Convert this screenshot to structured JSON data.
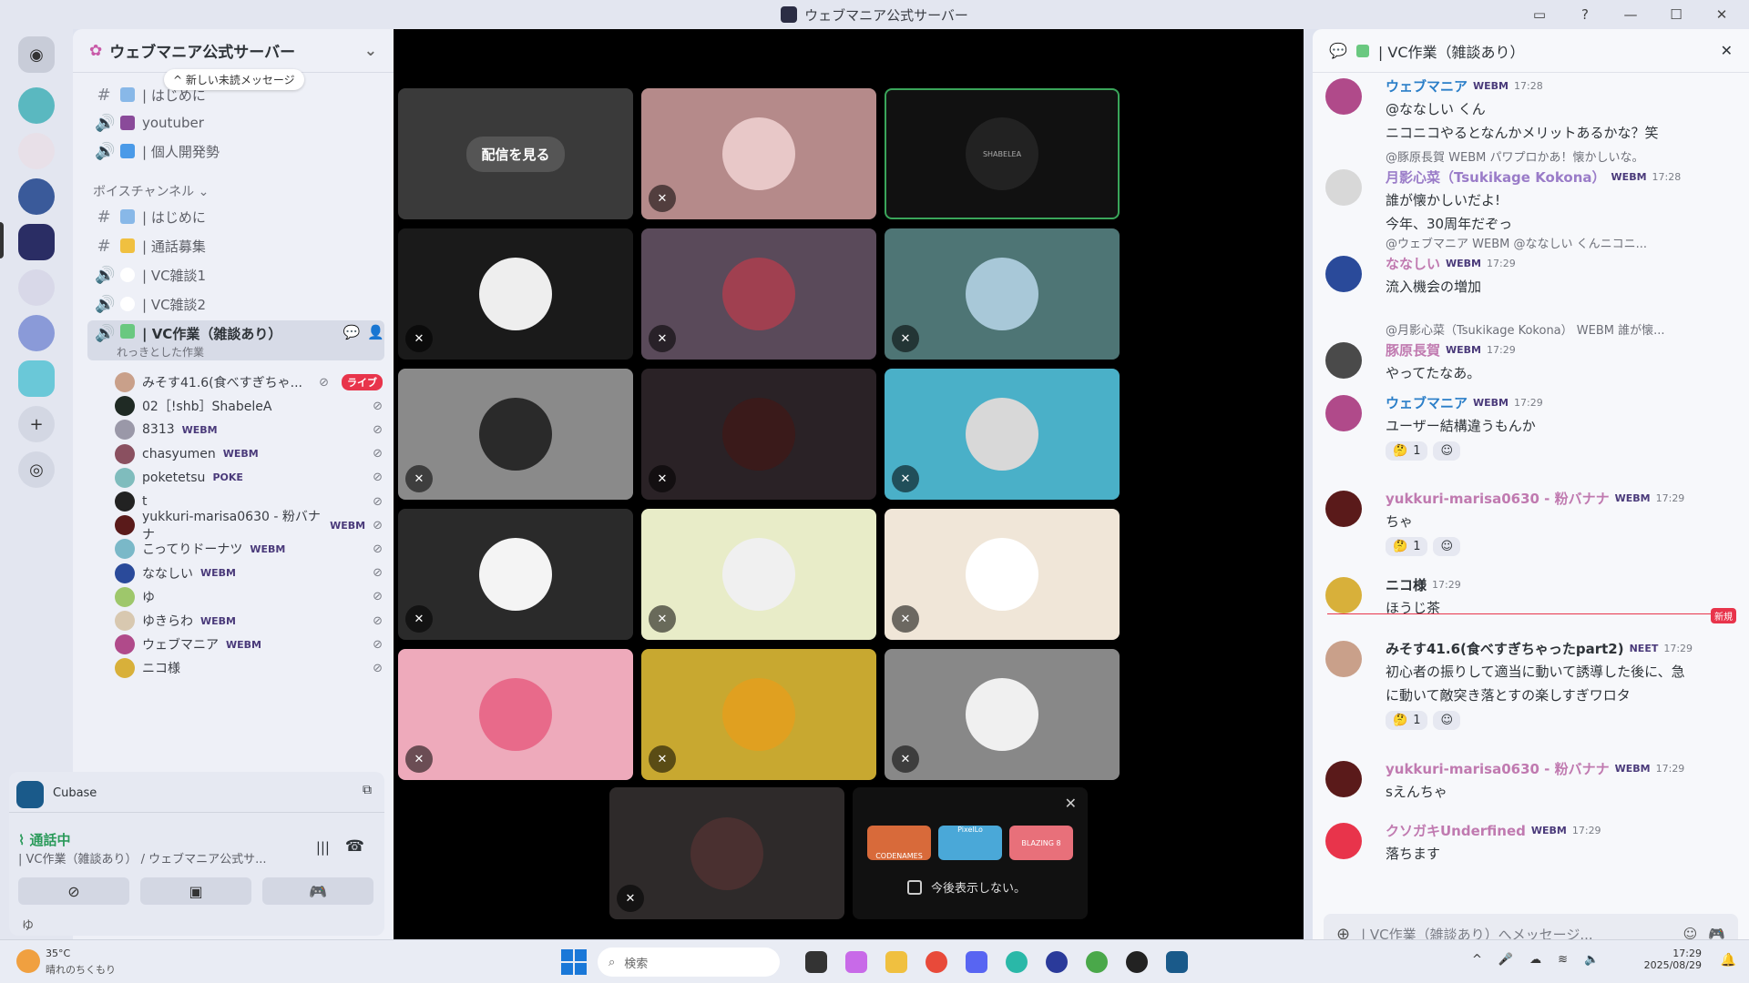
{
  "window": {
    "title": "ウェブマニア公式サーバー"
  },
  "server": {
    "name": "ウェブマニア公式サーバー",
    "new_messages": "新しい未読メッセージ",
    "channels": [
      {
        "label": "| はじめに",
        "type": "text"
      },
      {
        "label": "youtuber",
        "type": "voice"
      },
      {
        "label": "| 個人開発勢",
        "type": "voice"
      }
    ],
    "voice_category": "ボイスチャンネル",
    "voice_channels": [
      {
        "label": "| はじめに",
        "type": "text"
      },
      {
        "label": "| 通話募集",
        "type": "text"
      },
      {
        "label": "| VC雑談1",
        "type": "voice"
      },
      {
        "label": "| VC雑談2",
        "type": "voice"
      },
      {
        "label": "| VC作業（雑談あり）",
        "type": "voice",
        "status": "れっきとした作業"
      }
    ],
    "voice_members": [
      {
        "name": "みそす41.6(食べすぎちゃ...",
        "tag": "",
        "live": "ライブ",
        "color": "#c9a08a"
      },
      {
        "name": "02［!shb］ShabeleA",
        "tag": "",
        "color": "#1f2a24"
      },
      {
        "name": "8313",
        "tag": "WEBM",
        "color": "#9a98a8"
      },
      {
        "name": "chasyumen",
        "tag": "WEBM",
        "color": "#8a5060"
      },
      {
        "name": "poketetsu",
        "tag": "POKE",
        "color": "#7fbcbd"
      },
      {
        "name": "t",
        "tag": "",
        "color": "#222"
      },
      {
        "name": "yukkuri-marisa0630 - 粉バナナ",
        "tag": "WEBM",
        "color": "#5a1a1a"
      },
      {
        "name": "こってりドーナツ",
        "tag": "WEBM",
        "color": "#7ab8c8"
      },
      {
        "name": "ななしい",
        "tag": "WEBM",
        "color": "#2a4a9a"
      },
      {
        "name": "ゆ",
        "tag": "",
        "color": "#9ec76b"
      },
      {
        "name": "ゆきらわ",
        "tag": "WEBM",
        "color": "#d8c8b0"
      },
      {
        "name": "ウェブマニア",
        "tag": "WEBM",
        "color": "#b04a8a"
      },
      {
        "name": "ニコ様",
        "tag": "",
        "color": "#d8b03a"
      }
    ]
  },
  "user_panel": {
    "activity": "Cubase",
    "status": "通話中",
    "channel": "| VC作業（雑談あり） / ウェブマニア公式サ...",
    "user": "ゆ"
  },
  "stage": {
    "watch_label": "配信を見る",
    "shabelea_label": "SHABELEA",
    "tiles": [
      {
        "bg": "#3a3a3a",
        "avatar": "",
        "muted": false,
        "stream": true
      },
      {
        "bg": "#b58a8a",
        "avatar": "#e8c8c8",
        "muted": true
      },
      {
        "bg": "#111111",
        "avatar": "#222222",
        "muted": false,
        "speaking": true
      },
      {
        "bg": "#1a1a1a",
        "avatar": "#eeeeee",
        "muted": true
      },
      {
        "bg": "#5a4a5a",
        "avatar": "#a04050",
        "muted": true
      },
      {
        "bg": "#4e7575",
        "avatar": "#a8c8d8",
        "muted": true
      },
      {
        "bg": "#8a8a8a",
        "avatar": "#2a2a2a",
        "muted": true
      },
      {
        "bg": "#2a2226",
        "avatar": "#3a1a1a",
        "muted": true
      },
      {
        "bg": "#4ab0c8",
        "avatar": "#d8d8d8",
        "muted": true
      },
      {
        "bg": "#2a2a2a",
        "avatar": "#f4f4f4",
        "muted": true
      },
      {
        "bg": "#e8ecc8",
        "avatar": "#f0f0f0",
        "muted": true
      },
      {
        "bg": "#f0e6d8",
        "avatar": "#ffffff",
        "muted": true
      },
      {
        "bg": "#eeaabb",
        "avatar": "#e86a8a",
        "muted": true
      },
      {
        "bg": "#c8a830",
        "avatar": "#e0a020",
        "muted": true
      },
      {
        "bg": "#888888",
        "avatar": "#f0f0f0",
        "muted": true
      }
    ],
    "bottom_tile": {
      "bg": "#2e2a2a",
      "avatar": "#4a3030"
    },
    "popup_checkbox": "今後表示しない。",
    "popup_games": [
      "CODENAMES",
      "PixelLo",
      "BLAZING 8"
    ]
  },
  "chat": {
    "title": "| VC作業（雑談あり）",
    "input_placeholder": "| VC作業（雑談あり）へメッセージ...",
    "new_divider": "新規",
    "messages": [
      {
        "author": "ウェブマニア",
        "tag": "WEBM",
        "time": "17:28",
        "color": "#2a7ec8",
        "av": "#b04a8a",
        "lines": [
          "@ななしい くん",
          "ニコニコやるとなんかメリットあるかな？笑"
        ]
      },
      {
        "reply": "@豚原長賀 WEBM パワプロかあ！懐かしいな。",
        "author": "月影心菜（Tsukikage Kokona）",
        "tag": "WEBM",
        "time": "17:28",
        "color": "#9a7cc8",
        "av": "#d8d8d8",
        "lines": [
          "誰が懐かしいだよ!",
          "今年、30周年だぞっ"
        ]
      },
      {
        "reply": "@ウェブマニア WEBM @ななしい くんニコニ...",
        "author": "ななしい",
        "tag": "WEBM",
        "time": "17:29",
        "color": "#c07ab0",
        "av": "#2a4a9a",
        "lines": [
          "流入機会の増加"
        ]
      },
      {
        "reply": "@月影心菜（Tsukikage Kokona） WEBM 誰が懐...",
        "author": "豚原長賀",
        "tag": "WEBM",
        "time": "17:29",
        "color": "#c07ab0",
        "av": "#4a4a4a",
        "lines": [
          "やってたなあ。"
        ]
      },
      {
        "author": "ウェブマニア",
        "tag": "WEBM",
        "time": "17:29",
        "color": "#2a7ec8",
        "av": "#b04a8a",
        "lines": [
          "ユーザー結構違うもんか"
        ],
        "reaction": "1"
      },
      {
        "author": "yukkuri-marisa0630 - 粉バナナ",
        "tag": "WEBM",
        "time": "17:29",
        "color": "#c07ab0",
        "av": "#5a1a1a",
        "lines": [
          "ちゃ"
        ],
        "reaction": "1"
      },
      {
        "author": "ニコ様",
        "tag": "",
        "time": "17:29",
        "color": "#2e3338",
        "av": "#d8b03a",
        "lines": [
          "ほうじ茶"
        ]
      },
      {
        "author": "みそす41.6(食べすぎちゃったpart2)",
        "tag": "NEET",
        "time": "17:29",
        "color": "#2e3338",
        "av": "#c9a08a",
        "lines": [
          "初心者の振りして適当に動いて誘導した後に、急",
          "に動いて敵突き落とすの楽しすぎワロタ"
        ],
        "reaction": "1"
      },
      {
        "author": "yukkuri-marisa0630 - 粉バナナ",
        "tag": "WEBM",
        "time": "17:29",
        "color": "#c07ab0",
        "av": "#5a1a1a",
        "lines": [
          "sえんちゃ"
        ]
      },
      {
        "author": "クソガキUnderfined",
        "tag": "WEBM",
        "time": "17:29",
        "color": "#c07ab0",
        "av": "#e8344b",
        "lines": [
          "落ちます"
        ]
      }
    ]
  },
  "taskbar": {
    "weather_temp": "35°C",
    "weather_desc": "晴れのちくもり",
    "search_placeholder": "検索",
    "time": "17:29",
    "date": "2025/08/29"
  }
}
